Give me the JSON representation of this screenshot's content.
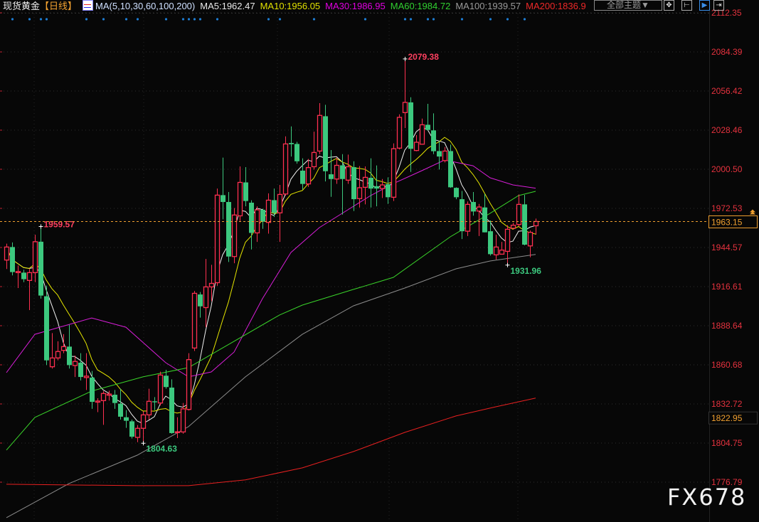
{
  "header": {
    "instrument": "现货黄金",
    "period": "【日线】",
    "ma_icon": "ma-indicator-icon",
    "ma_params": "MA(5,10,30,60,100,200)",
    "ma_values": [
      {
        "label": "MA5:1962.47",
        "color": "#e8e8e8"
      },
      {
        "label": "MA10:1956.05",
        "color": "#e0e000"
      },
      {
        "label": "MA30:1986.95",
        "color": "#e000e0"
      },
      {
        "label": "MA60:1984.72",
        "color": "#30d030"
      },
      {
        "label": "MA100:1939.57",
        "color": "#9a9a9a"
      },
      {
        "label": "MA200:1836.9",
        "color": "#ee2828"
      }
    ],
    "theme_button": "全部主题▼",
    "tools": [
      {
        "icon": "crosshair-icon",
        "glyph": "✥"
      },
      {
        "icon": "range-icon",
        "glyph": "⊢"
      },
      {
        "icon": "play-icon",
        "glyph": "▶"
      },
      {
        "icon": "goto-end-icon",
        "glyph": "⇥"
      }
    ]
  },
  "watermark": "FX678",
  "chart_data": {
    "type": "candlestick",
    "ylim": [
      1776.79,
      2112.35
    ],
    "y_ticks": [
      "2112.35",
      "2084.39",
      "2056.42",
      "2028.46",
      "2000.50",
      "1972.53",
      "1944.57",
      "1916.61",
      "1888.64",
      "1860.68",
      "1832.72",
      "1804.75",
      "1776.79"
    ],
    "grid": true,
    "colors": {
      "up": "#ff3050",
      "down": "#3cc87e",
      "axis_text": "#e5323e",
      "last_price": "#f0a030"
    },
    "last_price": "1963.15",
    "axis_marker": "1822.95",
    "annotations": [
      {
        "text": "1959.57",
        "candle": 7,
        "type": "high"
      },
      {
        "text": "2079.38",
        "candle": 71,
        "type": "high"
      },
      {
        "text": "1804.63",
        "candle": 25,
        "type": "low"
      },
      {
        "text": "1931.96",
        "candle": 89,
        "type": "low"
      }
    ],
    "event_markers": [
      2,
      5,
      7,
      8,
      15,
      18,
      22,
      24,
      29,
      32,
      33,
      34,
      35,
      38,
      47,
      49,
      55,
      64,
      71,
      72,
      75,
      76,
      81,
      86,
      89,
      92
    ],
    "ohlc": [
      [
        1935.6,
        1947.3,
        1929.2,
        1944.9
      ],
      [
        1944.9,
        1948.2,
        1924.6,
        1927.0
      ],
      [
        1926.6,
        1931.7,
        1915.6,
        1927.4
      ],
      [
        1926.6,
        1928.7,
        1919.8,
        1921.9
      ],
      [
        1921.0,
        1929.2,
        1899.8,
        1926.6
      ],
      [
        1926.6,
        1953.7,
        1919.8,
        1948.7
      ],
      [
        1948.7,
        1959.57,
        1908.0,
        1910.2
      ],
      [
        1909.7,
        1917.3,
        1860.5,
        1863.9
      ],
      [
        1859.3,
        1883.4,
        1858.0,
        1865.6
      ],
      [
        1865.6,
        1877.5,
        1863.9,
        1870.2
      ],
      [
        1871.0,
        1882.6,
        1869.0,
        1873.7
      ],
      [
        1873.7,
        1889.3,
        1858.0,
        1860.5
      ],
      [
        1860.2,
        1867.3,
        1852.0,
        1863.1
      ],
      [
        1862.2,
        1869.0,
        1849.5,
        1852.0
      ],
      [
        1851.6,
        1869.0,
        1842.7,
        1852.6
      ],
      [
        1851.6,
        1856.3,
        1829.2,
        1834.2
      ],
      [
        1834.0,
        1836.8,
        1826.9,
        1834.8
      ],
      [
        1835.1,
        1841.9,
        1817.8,
        1840.2
      ],
      [
        1839.0,
        1842.2,
        1835.1,
        1839.8
      ],
      [
        1839.3,
        1842.7,
        1829.2,
        1833.4
      ],
      [
        1832.9,
        1843.6,
        1821.5,
        1823.6
      ],
      [
        1823.2,
        1828.3,
        1815.6,
        1820.7
      ],
      [
        1820.3,
        1821.5,
        1808.0,
        1809.3
      ],
      [
        1808.8,
        1817.6,
        1805.4,
        1815.3
      ],
      [
        1815.3,
        1827.5,
        1804.63,
        1824.9
      ],
      [
        1824.9,
        1843.6,
        1821.5,
        1834.6
      ],
      [
        1834.6,
        1837.6,
        1828.3,
        1833.9
      ],
      [
        1833.4,
        1855.8,
        1831.7,
        1853.4
      ],
      [
        1852.9,
        1857.1,
        1843.6,
        1844.8
      ],
      [
        1844.4,
        1850.3,
        1811.4,
        1811.9
      ],
      [
        1812.2,
        1823.2,
        1808.3,
        1812.8
      ],
      [
        1812.7,
        1833.4,
        1811.4,
        1829.2
      ],
      [
        1828.8,
        1869.0,
        1828.0,
        1864.4
      ],
      [
        1872.7,
        1913.5,
        1870.6,
        1911.8
      ],
      [
        1911.0,
        1912.7,
        1894.4,
        1902.5
      ],
      [
        1901.6,
        1936.4,
        1887.6,
        1916.4
      ],
      [
        1916.4,
        1932.2,
        1906.2,
        1918.9
      ],
      [
        1919.4,
        1986.7,
        1917.2,
        1982.0
      ],
      [
        1982.0,
        2008.8,
        1964.7,
        1977.1
      ],
      [
        1977.1,
        1984.2,
        1934.2,
        1938.1
      ],
      [
        1938.1,
        1972.7,
        1933.3,
        1967.8
      ],
      [
        1967.2,
        2002.5,
        1963.5,
        1991.1
      ],
      [
        1991.1,
        2002.0,
        1974.0,
        1977.8
      ],
      [
        1976.6,
        1978.3,
        1943.2,
        1955.0
      ],
      [
        1955.0,
        1974.0,
        1948.6,
        1971.5
      ],
      [
        1971.5,
        1972.3,
        1957.9,
        1963.0
      ],
      [
        1962.5,
        1983.3,
        1954.5,
        1978.4
      ],
      [
        1978.4,
        1986.7,
        1966.4,
        1969.3
      ],
      [
        1969.3,
        1989.3,
        1948.6,
        1982.5
      ],
      [
        1982.8,
        2024.0,
        1981.7,
        2018.6
      ],
      [
        2019.3,
        2031.1,
        2009.6,
        2018.4
      ],
      [
        2018.6,
        2020.1,
        2004.5,
        2006.2
      ],
      [
        1999.5,
        2008.3,
        1985.9,
        1990.0
      ],
      [
        1990.0,
        2007.9,
        1987.9,
        2001.7
      ],
      [
        2002.3,
        2027.4,
        2000.3,
        2012.5
      ],
      [
        2013.5,
        2047.8,
        2011.3,
        2039.0
      ],
      [
        2038.4,
        2046.6,
        1991.8,
        1999.1
      ],
      [
        1996.9,
        2014.2,
        1980.8,
        1993.5
      ],
      [
        1993.5,
        2008.8,
        1990.1,
        2003.3
      ],
      [
        2003.3,
        2011.3,
        1968.1,
        1993.5
      ],
      [
        1992.7,
        2011.0,
        1990.1,
        2002.3
      ],
      [
        2002.0,
        2006.2,
        1970.6,
        1979.1
      ],
      [
        1979.5,
        2002.8,
        1973.2,
        1987.3
      ],
      [
        1987.6,
        2002.5,
        1975.4,
        1994.7
      ],
      [
        1994.4,
        2008.3,
        1973.2,
        1986.7
      ],
      [
        1988.4,
        2003.2,
        1974.0,
        1986.7
      ],
      [
        1986.7,
        1993.5,
        1980.0,
        1989.3
      ],
      [
        1989.8,
        1994.7,
        1975.7,
        1980.5
      ],
      [
        1980.5,
        2019.0,
        1977.8,
        2015.2
      ],
      [
        2015.6,
        2039.8,
        2014.7,
        2037.6
      ],
      [
        2041.0,
        2079.38,
        2030.0,
        2048.3
      ],
      [
        2048.3,
        2052.0,
        1998.6,
        2015.1
      ],
      [
        2013.9,
        2024.9,
        2013.4,
        2019.8
      ],
      [
        2018.4,
        2036.7,
        2018.1,
        2032.3
      ],
      [
        2032.3,
        2047.3,
        2028.3,
        2028.6
      ],
      [
        2028.3,
        2040.5,
        2011.3,
        2013.4
      ],
      [
        2013.5,
        2020.6,
        2000.3,
        2009.6
      ],
      [
        2006.7,
        2016.4,
        2005.4,
        2013.5
      ],
      [
        2013.5,
        2018.1,
        1987.2,
        1987.6
      ],
      [
        1987.2,
        1987.6,
        1979.1,
        1980.5
      ],
      [
        1979.1,
        1985.0,
        1950.6,
        1956.2
      ],
      [
        1956.2,
        1977.4,
        1952.8,
        1975.4
      ],
      [
        1977.1,
        1984.2,
        1967.3,
        1970.3
      ],
      [
        1970.6,
        1975.7,
        1952.8,
        1973.5
      ],
      [
        1973.2,
        1982.8,
        1955.4,
        1955.4
      ],
      [
        1956.2,
        1963.9,
        1938.8,
        1939.8
      ],
      [
        1939.3,
        1953.7,
        1935.9,
        1944.9
      ],
      [
        1939.8,
        1948.6,
        1939.8,
        1942.7
      ],
      [
        1941.8,
        1960.5,
        1931.96,
        1957.6
      ],
      [
        1958.3,
        1962.2,
        1957.9,
        1960.5
      ],
      [
        1961.0,
        1982.5,
        1959.6,
        1975.4
      ],
      [
        1975.4,
        1982.2,
        1946.1,
        1946.6
      ],
      [
        1945.7,
        1956.7,
        1937.6,
        1955.4
      ],
      [
        1960.1,
        1965.2,
        1953.7,
        1963.15
      ]
    ],
    "moving_averages": [
      {
        "name": "MA5",
        "period": 5,
        "color": "#f0f0f0"
      },
      {
        "name": "MA10",
        "period": 10,
        "color": "#e6e600"
      },
      {
        "name": "MA30",
        "color": "#d81ed8",
        "points": [
          [
            1,
            1855.1
          ],
          [
            6,
            1882.5
          ],
          [
            16,
            1894.2
          ],
          [
            22,
            1887.6
          ],
          [
            29,
            1862.2
          ],
          [
            33,
            1852.1
          ],
          [
            37,
            1855.6
          ],
          [
            41,
            1869.8
          ],
          [
            46,
            1908.0
          ],
          [
            51,
            1941.0
          ],
          [
            56,
            1958.8
          ],
          [
            61,
            1971.5
          ],
          [
            65,
            1981.7
          ],
          [
            69,
            1990.3
          ],
          [
            74,
            1999.5
          ],
          [
            78,
            2007.1
          ],
          [
            83,
            2003.0
          ],
          [
            86,
            1994.4
          ],
          [
            90,
            1989.3
          ],
          [
            94,
            1986.95
          ]
        ]
      },
      {
        "name": "MA60",
        "color": "#3ad42a",
        "points": [
          [
            1,
            1799.7
          ],
          [
            6,
            1823.1
          ],
          [
            16,
            1841.9
          ],
          [
            25,
            1852.1
          ],
          [
            33,
            1858.7
          ],
          [
            41,
            1877.5
          ],
          [
            49,
            1896.3
          ],
          [
            53,
            1903.4
          ],
          [
            62,
            1914.6
          ],
          [
            67,
            1920.7
          ],
          [
            69,
            1923.2
          ],
          [
            79,
            1952.2
          ],
          [
            86,
            1969.0
          ],
          [
            91,
            1981.7
          ],
          [
            94,
            1984.72
          ]
        ]
      },
      {
        "name": "MA100",
        "color": "#8c8c8c",
        "points": [
          [
            1,
            1751.4
          ],
          [
            12,
            1775.8
          ],
          [
            24,
            1796.1
          ],
          [
            33,
            1816.5
          ],
          [
            43,
            1852.1
          ],
          [
            53,
            1882.5
          ],
          [
            62,
            1902.9
          ],
          [
            71,
            1915.6
          ],
          [
            80,
            1929.3
          ],
          [
            86,
            1934.9
          ],
          [
            94,
            1939.57
          ]
        ]
      },
      {
        "name": "MA200",
        "color": "#e82020",
        "points": [
          [
            1,
            1775.3
          ],
          [
            24,
            1774.3
          ],
          [
            33,
            1774.3
          ],
          [
            43,
            1778.4
          ],
          [
            53,
            1787.0
          ],
          [
            62,
            1798.7
          ],
          [
            71,
            1812.4
          ],
          [
            80,
            1824.1
          ],
          [
            87,
            1830.7
          ],
          [
            94,
            1836.9
          ]
        ]
      }
    ]
  }
}
